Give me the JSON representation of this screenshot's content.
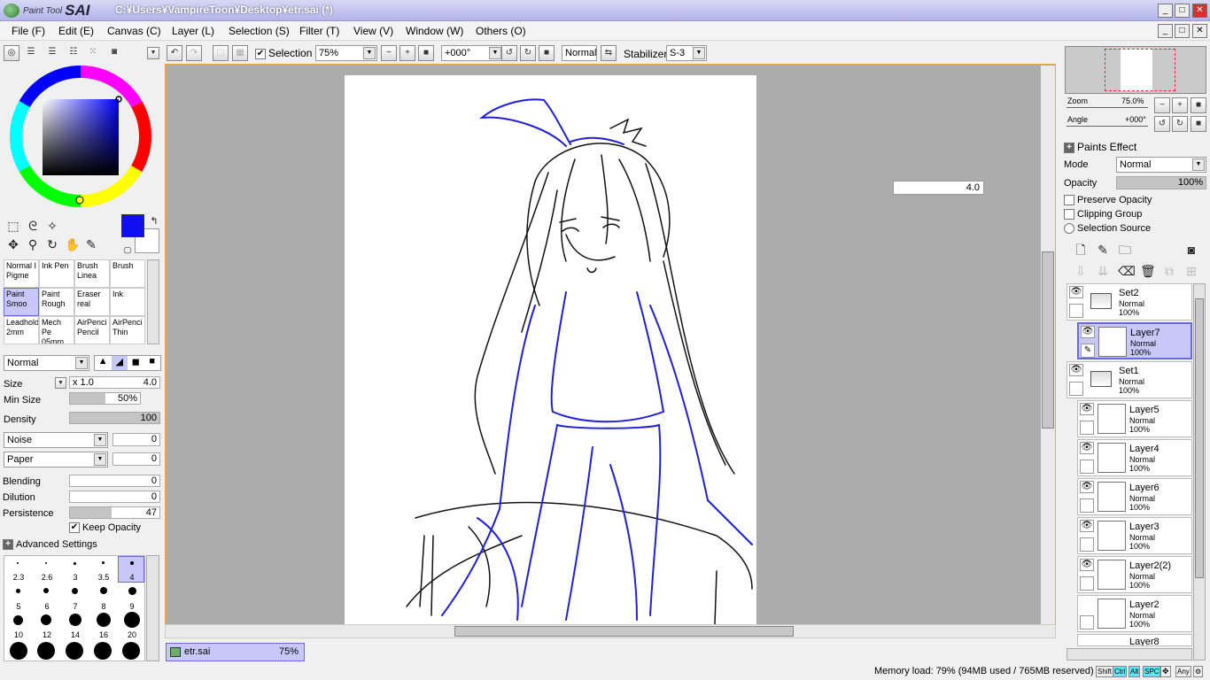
{
  "app": {
    "logo_small": "Paint Tool",
    "logo_big": "SAI",
    "title": "C:¥Users¥VampireToon¥Desktop¥etr.sai (*)"
  },
  "menu": [
    "File (F)",
    "Edit (E)",
    "Canvas (C)",
    "Layer (L)",
    "Selection (S)",
    "Filter (T)",
    "View (V)",
    "Window (W)",
    "Others (O)"
  ],
  "toolbar": {
    "selection_label": "Selection",
    "selection_checked": true,
    "zoom": "75%",
    "angle": "+000°",
    "blend": "Normal",
    "stabilizer_label": "Stabilizer",
    "stabilizer": "S-3"
  },
  "colors": {
    "primary": "#0f0ff0",
    "accent": "#6a6ad8",
    "border": "#e8a848"
  },
  "brushes": [
    {
      "l1": "Normal I",
      "l2": "Pigme"
    },
    {
      "l1": "Ink Pen",
      "l2": ""
    },
    {
      "l1": "Brush",
      "l2": "Linea"
    },
    {
      "l1": "Brush",
      "l2": ""
    },
    {
      "l1": "Paint",
      "l2": "Smoo"
    },
    {
      "l1": "Paint",
      "l2": "Rough"
    },
    {
      "l1": "Eraser",
      "l2": "real"
    },
    {
      "l1": "Ink",
      "l2": ""
    },
    {
      "l1": "Leadhold",
      "l2": "2mm"
    },
    {
      "l1": "Mech Pe",
      "l2": "05mm"
    },
    {
      "l1": "AirPenci",
      "l2": "Pencil"
    },
    {
      "l1": "AirPenci",
      "l2": "Thin"
    }
  ],
  "brush_settings": {
    "mode": "Normal",
    "size_label": "Size",
    "size_mult": "x 1.0",
    "size": "4.0",
    "minsize_label": "Min Size",
    "minsize": "50%",
    "density_label": "Density",
    "density": "100",
    "noise": "Noise",
    "noise_val": "0",
    "paper": "Paper",
    "paper_val": "0",
    "blending_label": "Blending",
    "blending": "0",
    "dilution_label": "Dilution",
    "dilution": "0",
    "persistence_label": "Persistence",
    "persistence": "47",
    "keep_opacity": "Keep Opacity",
    "advanced": "Advanced Settings"
  },
  "brush_sizes": [
    "2.3",
    "2.6",
    "3",
    "3.5",
    "4",
    "5",
    "6",
    "7",
    "8",
    "9",
    "10",
    "12",
    "14",
    "16",
    "20"
  ],
  "canvas": {
    "size_readout": "4.0"
  },
  "tab": {
    "name": "etr.sai",
    "zoom": "75%"
  },
  "status": {
    "memory": "Memory load: 79% (94MB used / 765MB reserved)",
    "keys": [
      "Shift",
      "Ctrl",
      "Alt",
      "SPC",
      "Any"
    ]
  },
  "navigator": {
    "zoom_label": "Zoom",
    "zoom": "75.0%",
    "angle_label": "Angle",
    "angle": "+000°"
  },
  "layer_props": {
    "paints_effect": "Paints Effect",
    "mode_label": "Mode",
    "mode": "Normal",
    "opacity_label": "Opacity",
    "opacity": "100%",
    "preserve": "Preserve Opacity",
    "clipping": "Clipping Group",
    "selsource": "Selection Source"
  },
  "layers": [
    {
      "name": "Set2",
      "mode": "Normal",
      "opacity": "100%",
      "folder": true,
      "selected": false
    },
    {
      "name": "Layer7",
      "mode": "Normal",
      "opacity": "100%",
      "folder": false,
      "selected": true
    },
    {
      "name": "Set1",
      "mode": "Normal",
      "opacity": "100%",
      "folder": true,
      "selected": false
    },
    {
      "name": "Layer5",
      "mode": "Normal",
      "opacity": "100%",
      "folder": false,
      "selected": false
    },
    {
      "name": "Layer4",
      "mode": "Normal",
      "opacity": "100%",
      "folder": false,
      "selected": false
    },
    {
      "name": "Layer6",
      "mode": "Normal",
      "opacity": "100%",
      "folder": false,
      "selected": false
    },
    {
      "name": "Layer3",
      "mode": "Normal",
      "opacity": "100%",
      "folder": false,
      "selected": false
    },
    {
      "name": "Layer2(2)",
      "mode": "Normal",
      "opacity": "100%",
      "folder": false,
      "selected": false
    },
    {
      "name": "Layer2",
      "mode": "Normal",
      "opacity": "100%",
      "folder": false,
      "selected": false
    },
    {
      "name": "Layer8",
      "mode": "",
      "opacity": "",
      "folder": false,
      "selected": false
    }
  ]
}
